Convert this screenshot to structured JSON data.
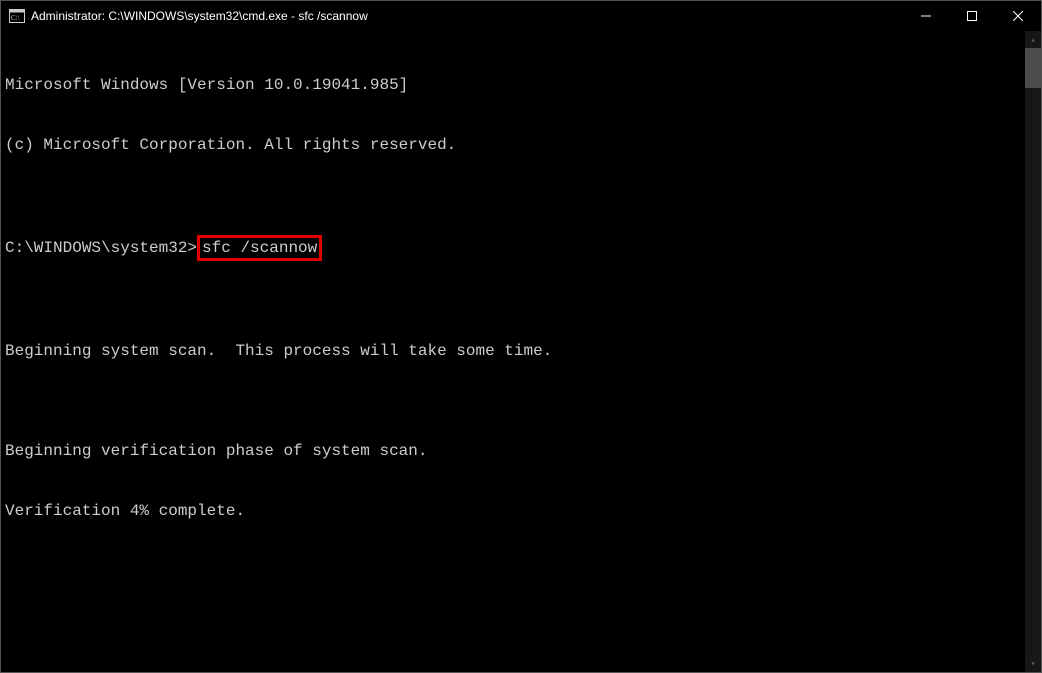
{
  "titlebar": {
    "title": "Administrator: C:\\WINDOWS\\system32\\cmd.exe - sfc  /scannow"
  },
  "terminal": {
    "line1": "Microsoft Windows [Version 10.0.19041.985]",
    "line2": "(c) Microsoft Corporation. All rights reserved.",
    "blank1": "",
    "prompt": "C:\\WINDOWS\\system32>",
    "command": "sfc /scannow",
    "blank2": "",
    "line3": "Beginning system scan.  This process will take some time.",
    "blank3": "",
    "line4": "Beginning verification phase of system scan.",
    "line5": "Verification 4% complete."
  },
  "scrollbar": {
    "up_glyph": "▴",
    "down_glyph": "▾"
  }
}
